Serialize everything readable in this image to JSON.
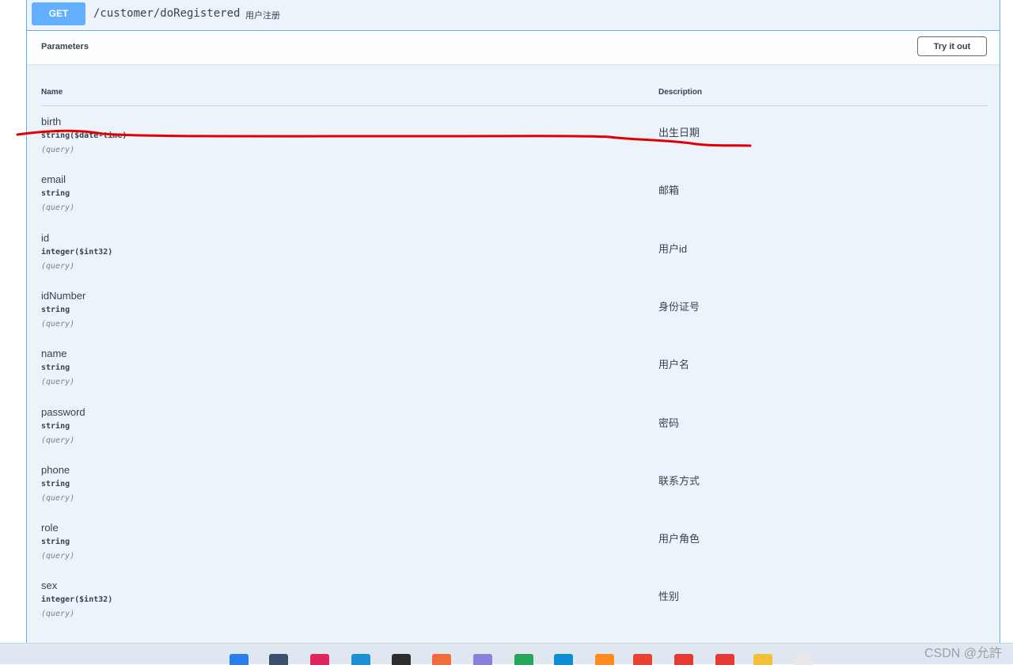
{
  "operation": {
    "method": "GET",
    "path": "/customer/doRegistered",
    "summary": "用户注册"
  },
  "parameters_section": {
    "title": "Parameters",
    "try_it_out": "Try it out",
    "columns": {
      "name": "Name",
      "description": "Description"
    }
  },
  "parameters": [
    {
      "name": "birth",
      "type": "string($date-time)",
      "in": "(query)",
      "description": "出生日期"
    },
    {
      "name": "email",
      "type": "string",
      "in": "(query)",
      "description": "邮箱"
    },
    {
      "name": "id",
      "type": "integer($int32)",
      "in": "(query)",
      "description": "用户id"
    },
    {
      "name": "idNumber",
      "type": "string",
      "in": "(query)",
      "description": "身份证号"
    },
    {
      "name": "name",
      "type": "string",
      "in": "(query)",
      "description": "用户名"
    },
    {
      "name": "password",
      "type": "string",
      "in": "(query)",
      "description": "密码"
    },
    {
      "name": "phone",
      "type": "string",
      "in": "(query)",
      "description": "联系方式"
    },
    {
      "name": "role",
      "type": "string",
      "in": "(query)",
      "description": "用户角色"
    },
    {
      "name": "sex",
      "type": "integer($int32)",
      "in": "(query)",
      "description": "性别"
    }
  ],
  "taskbar": {
    "icons": [
      "windows-start-icon",
      "file-explorer-icon",
      "intellij-icon",
      "toolbox-icon",
      "terminal-icon",
      "postman-icon",
      "flask-icon",
      "hbuilder-icon",
      "edge-icon",
      "firefox-icon",
      "chrome-icon",
      "xshell-icon",
      "xftp-icon",
      "folder-icon",
      "document-icon"
    ]
  },
  "watermark": "CSDN @允許",
  "colors": {
    "get_method": "#61affe",
    "panel_background": "#ebf3fb",
    "annotation_stroke": "#e00000"
  }
}
